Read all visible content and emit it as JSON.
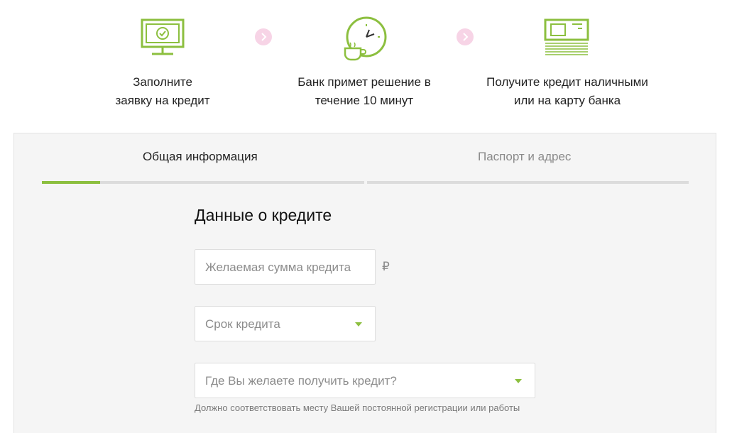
{
  "steps": [
    {
      "icon": "monitor-check-icon",
      "line1": "Заполните",
      "line2": "заявку на кредит"
    },
    {
      "icon": "clock-coffee-icon",
      "line1": "Банк примет решение в",
      "line2": "течение 10 минут"
    },
    {
      "icon": "cash-stack-icon",
      "line1": "Получите кредит наличными",
      "line2": "или на карту банка"
    }
  ],
  "colors": {
    "accent": "#8cbf3f",
    "arrow_bg": "#f7d4e6",
    "panel_bg": "#f5f5f5"
  },
  "tabs": [
    {
      "label": "Общая информация",
      "active": true
    },
    {
      "label": "Паспорт и адрес",
      "active": false
    }
  ],
  "progress": {
    "fraction_of_first_tab": 0.18
  },
  "form": {
    "title": "Данные о кредите",
    "amount": {
      "placeholder": "Желаемая сумма кредита",
      "currency": "₽"
    },
    "term": {
      "placeholder": "Срок кредита"
    },
    "place": {
      "placeholder": "Где Вы желаете получить кредит?",
      "hint": "Должно соответствовать месту Вашей постоянной регистрации или работы"
    }
  }
}
